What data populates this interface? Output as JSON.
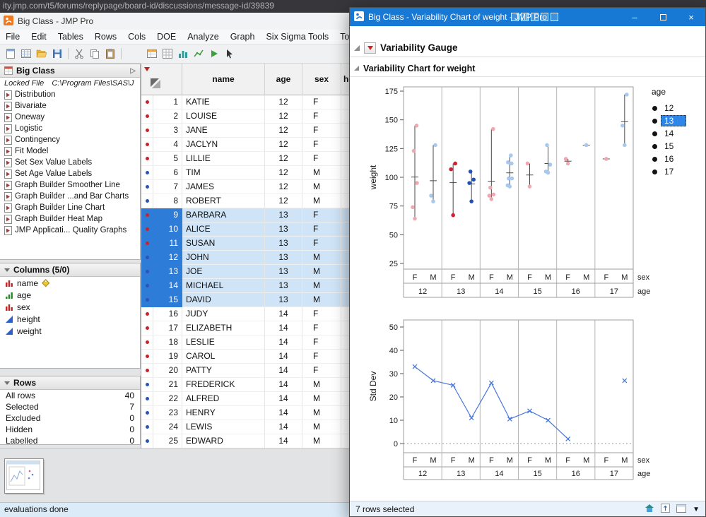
{
  "colors": {
    "selected-f": "#cf2030",
    "selected-m": "#2050b8",
    "unselected-f": "#f0a8b0",
    "unselected-m": "#a8c8ee",
    "line_blue": "#4a78d8",
    "titlebar_blue": "#1879d4",
    "row_selection": "#2d7cd7",
    "row_selection_light": "#cfe4f7"
  },
  "browser": {
    "url": "ity.jmp.com/t5/forums/replypage/board-id/discussions/message-id/39839"
  },
  "main_window": {
    "title": "Big Class - JMP Pro",
    "menus": [
      "File",
      "Edit",
      "Tables",
      "Rows",
      "Cols",
      "DOE",
      "Analyze",
      "Graph",
      "Six Sigma Tools",
      "Tools"
    ],
    "status": "evaluations done",
    "sidebar": {
      "table_panel": {
        "title": "Big Class",
        "locked_note": "Locked File",
        "locked_path": "C:\\Program Files\\SAS\\J",
        "scripts": [
          "Distribution",
          "Bivariate",
          "Oneway",
          "Logistic",
          "Contingency",
          "Fit Model",
          "Set Sex Value Labels",
          "Set Age Value Labels",
          "Graph Builder Smoother Line",
          "Graph Builder ...and Bar Charts",
          "Graph Builder Line Chart",
          "Graph Builder Heat Map",
          "JMP Applicati... Quality Graphs"
        ]
      },
      "columns_panel": {
        "title": "Columns (5/0)",
        "items": [
          {
            "label": "name",
            "type": "nominal",
            "tag": true
          },
          {
            "label": "age",
            "type": "ordinal",
            "tag": false
          },
          {
            "label": "sex",
            "type": "nominal",
            "tag": false
          },
          {
            "label": "height",
            "type": "continuous",
            "tag": false
          },
          {
            "label": "weight",
            "type": "continuous",
            "tag": false
          }
        ]
      },
      "rows_panel": {
        "title": "Rows",
        "stats": [
          {
            "label": "All rows",
            "value": "40"
          },
          {
            "label": "Selected",
            "value": "7"
          },
          {
            "label": "Excluded",
            "value": "0"
          },
          {
            "label": "Hidden",
            "value": "0"
          },
          {
            "label": "Labelled",
            "value": "0"
          }
        ]
      }
    },
    "grid": {
      "headers": [
        "name",
        "age",
        "sex",
        "height"
      ],
      "rows": [
        {
          "n": "1",
          "name": "KATIE",
          "age": "12",
          "sex": "F",
          "selected": false
        },
        {
          "n": "2",
          "name": "LOUISE",
          "age": "12",
          "sex": "F",
          "selected": false
        },
        {
          "n": "3",
          "name": "JANE",
          "age": "12",
          "sex": "F",
          "selected": false
        },
        {
          "n": "4",
          "name": "JACLYN",
          "age": "12",
          "sex": "F",
          "selected": false
        },
        {
          "n": "5",
          "name": "LILLIE",
          "age": "12",
          "sex": "F",
          "selected": false
        },
        {
          "n": "6",
          "name": "TIM",
          "age": "12",
          "sex": "M",
          "selected": false
        },
        {
          "n": "7",
          "name": "JAMES",
          "age": "12",
          "sex": "M",
          "selected": false
        },
        {
          "n": "8",
          "name": "ROBERT",
          "age": "12",
          "sex": "M",
          "selected": false
        },
        {
          "n": "9",
          "name": "BARBARA",
          "age": "13",
          "sex": "F",
          "selected": true
        },
        {
          "n": "10",
          "name": "ALICE",
          "age": "13",
          "sex": "F",
          "selected": true
        },
        {
          "n": "11",
          "name": "SUSAN",
          "age": "13",
          "sex": "F",
          "selected": true
        },
        {
          "n": "12",
          "name": "JOHN",
          "age": "13",
          "sex": "M",
          "selected": true
        },
        {
          "n": "13",
          "name": "JOE",
          "age": "13",
          "sex": "M",
          "selected": true
        },
        {
          "n": "14",
          "name": "MICHAEL",
          "age": "13",
          "sex": "M",
          "selected": true
        },
        {
          "n": "15",
          "name": "DAVID",
          "age": "13",
          "sex": "M",
          "selected": true
        },
        {
          "n": "16",
          "name": "JUDY",
          "age": "14",
          "sex": "F",
          "selected": false
        },
        {
          "n": "17",
          "name": "ELIZABETH",
          "age": "14",
          "sex": "F",
          "selected": false
        },
        {
          "n": "18",
          "name": "LESLIE",
          "age": "14",
          "sex": "F",
          "selected": false
        },
        {
          "n": "19",
          "name": "CAROL",
          "age": "14",
          "sex": "F",
          "selected": false
        },
        {
          "n": "20",
          "name": "PATTY",
          "age": "14",
          "sex": "F",
          "selected": false
        },
        {
          "n": "21",
          "name": "FREDERICK",
          "age": "14",
          "sex": "M",
          "selected": false
        },
        {
          "n": "22",
          "name": "ALFRED",
          "age": "14",
          "sex": "M",
          "selected": false
        },
        {
          "n": "23",
          "name": "HENRY",
          "age": "14",
          "sex": "M",
          "selected": false
        },
        {
          "n": "24",
          "name": "LEWIS",
          "age": "14",
          "sex": "M",
          "selected": false
        },
        {
          "n": "25",
          "name": "EDWARD",
          "age": "14",
          "sex": "M",
          "selected": false
        }
      ]
    }
  },
  "report_window": {
    "title": "Big Class - Variability Chart of weight - JMP Pro",
    "outline_top": "Variability Gauge",
    "outline_chart": "Variability Chart for weight",
    "status": "7 rows selected",
    "legend": {
      "title": "age",
      "items": [
        "12",
        "13",
        "14",
        "15",
        "16",
        "17"
      ],
      "selected": "13"
    }
  },
  "chart_data": [
    {
      "type": "scatter",
      "title": "Variability Chart for weight",
      "ylabel": "weight",
      "ylim": [
        20,
        179
      ],
      "yticks": [
        175,
        150,
        125,
        100,
        75,
        50,
        25
      ],
      "x_nesting": {
        "sex": [
          "F",
          "M"
        ],
        "age": [
          "12",
          "13",
          "14",
          "15",
          "16",
          "17"
        ]
      },
      "axis_row_labels": [
        "sex",
        "age"
      ],
      "cells": [
        {
          "age": "12",
          "sex": "F",
          "values": [
            64,
            74,
            95,
            123,
            145
          ],
          "state": "unselected-f"
        },
        {
          "age": "12",
          "sex": "M",
          "values": [
            79,
            84,
            128
          ],
          "state": "unselected-m"
        },
        {
          "age": "13",
          "sex": "F",
          "values": [
            67,
            107,
            112
          ],
          "state": "selected-f"
        },
        {
          "age": "13",
          "sex": "M",
          "values": [
            79,
            95,
            98,
            105
          ],
          "state": "selected-m"
        },
        {
          "age": "14",
          "sex": "F",
          "values": [
            81,
            84,
            85,
            91,
            142
          ],
          "state": "unselected-f"
        },
        {
          "age": "14",
          "sex": "M",
          "values": [
            92,
            93,
            99,
            99,
            112,
            113,
            119
          ],
          "state": "unselected-m"
        },
        {
          "age": "15",
          "sex": "F",
          "values": [
            92,
            112
          ],
          "state": "unselected-f"
        },
        {
          "age": "15",
          "sex": "M",
          "values": [
            104,
            105,
            111,
            128
          ],
          "state": "unselected-m"
        },
        {
          "age": "16",
          "sex": "F",
          "values": [
            112,
            116
          ],
          "state": "unselected-f"
        },
        {
          "age": "16",
          "sex": "M",
          "values": [
            128
          ],
          "state": "unselected-m"
        },
        {
          "age": "17",
          "sex": "F",
          "values": [
            116
          ],
          "state": "unselected-f"
        },
        {
          "age": "17",
          "sex": "M",
          "values": [
            128,
            145,
            172
          ],
          "state": "unselected-m"
        }
      ]
    },
    {
      "type": "line",
      "ylabel": "Std Dev",
      "ylim": [
        -4,
        53
      ],
      "yticks": [
        50,
        40,
        30,
        20,
        10,
        0
      ],
      "zero_reference_line": true,
      "values": [
        33,
        27,
        25,
        11,
        26,
        10.5,
        14,
        10,
        2,
        null,
        null,
        27
      ]
    }
  ]
}
